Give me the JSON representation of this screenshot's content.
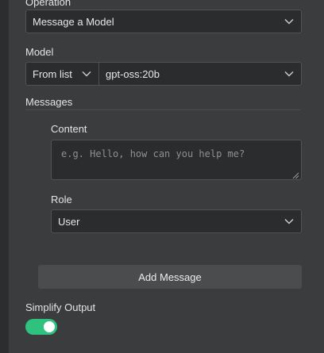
{
  "operation": {
    "label": "Operation",
    "value": "Message a Model"
  },
  "model": {
    "label": "Model",
    "mode": "From list",
    "value": "gpt-oss:20b"
  },
  "messages": {
    "label": "Messages",
    "content_label": "Content",
    "content_placeholder": "e.g. Hello, how can you help me?",
    "role_label": "Role",
    "role_value": "User",
    "add_button": "Add Message"
  },
  "simplify": {
    "label": "Simplify Output",
    "enabled": true
  },
  "colors": {
    "toggle_on": "#2ec27e"
  }
}
